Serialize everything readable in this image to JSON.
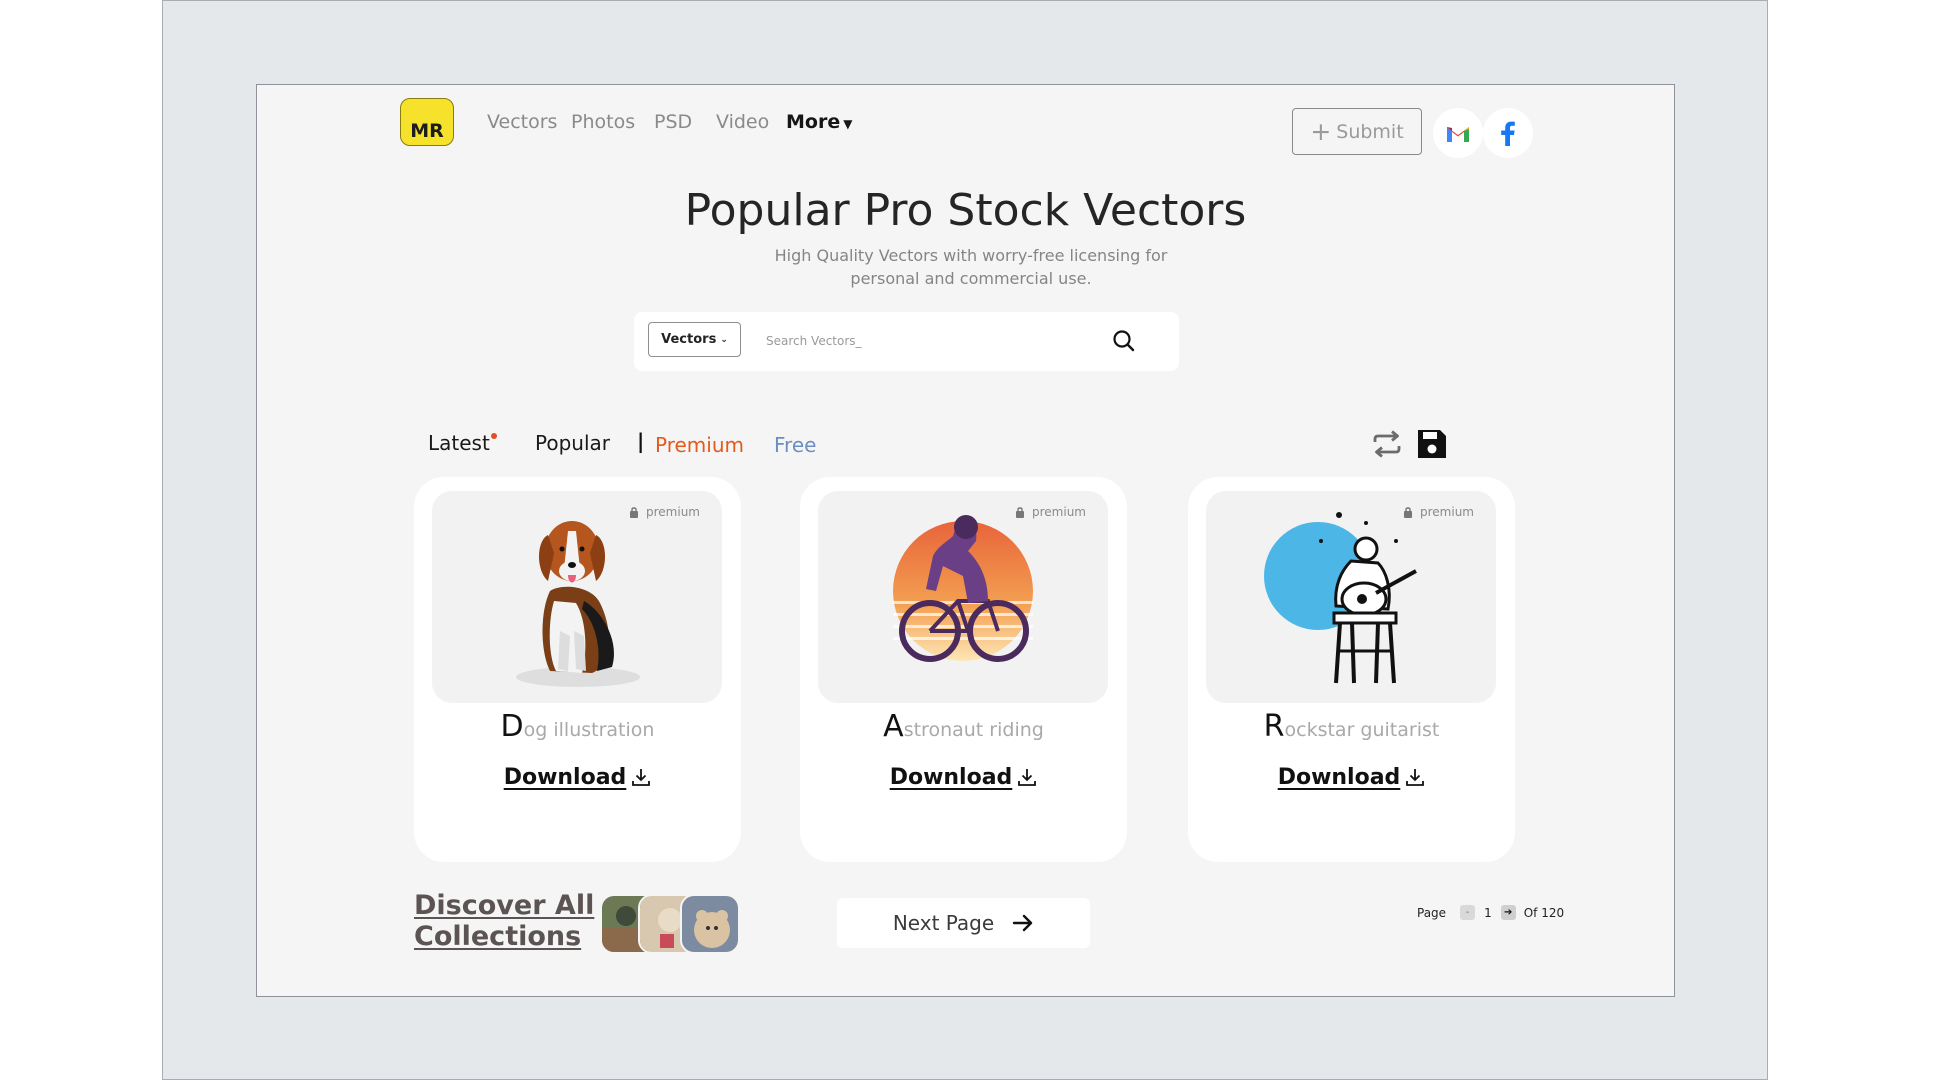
{
  "brand": {
    "logo_text": "MR",
    "logo_color": "#f7e22b"
  },
  "nav": {
    "links": [
      {
        "label": "Vectors"
      },
      {
        "label": "Photos"
      },
      {
        "label": "PSD"
      },
      {
        "label": "Video"
      }
    ],
    "more_label": "More",
    "submit_label": "Submit",
    "social": [
      {
        "icon": "gmail-icon"
      },
      {
        "icon": "facebook-icon"
      }
    ]
  },
  "hero": {
    "title": "Popular Pro Stock Vectors",
    "subtitle": "High Quality Vectors with worry-free licensing for personal and commercial use."
  },
  "search": {
    "category": "Vectors",
    "placeholder": "Search Vectors_"
  },
  "filters": {
    "latest": "Latest",
    "popular": "Popular",
    "separator": "|",
    "premium": "Premium",
    "free": "Free",
    "premium_color": "#e35a1d",
    "free_color": "#6d8ec2"
  },
  "cards": [
    {
      "badge": "premium",
      "title_initial": "D",
      "title_rest": "og illustration",
      "download": "Download"
    },
    {
      "badge": "premium",
      "title_initial": "A",
      "title_rest": "stronaut riding",
      "download": "Download"
    },
    {
      "badge": "premium",
      "title_initial": "R",
      "title_rest": "ockstar guitarist",
      "download": "Download"
    }
  ],
  "bottom": {
    "discover_line1": "Discover All",
    "discover_line2": "Collections",
    "next_page": "Next Page",
    "pager": {
      "label": "Page",
      "current": "1",
      "total": "Of 120"
    }
  }
}
